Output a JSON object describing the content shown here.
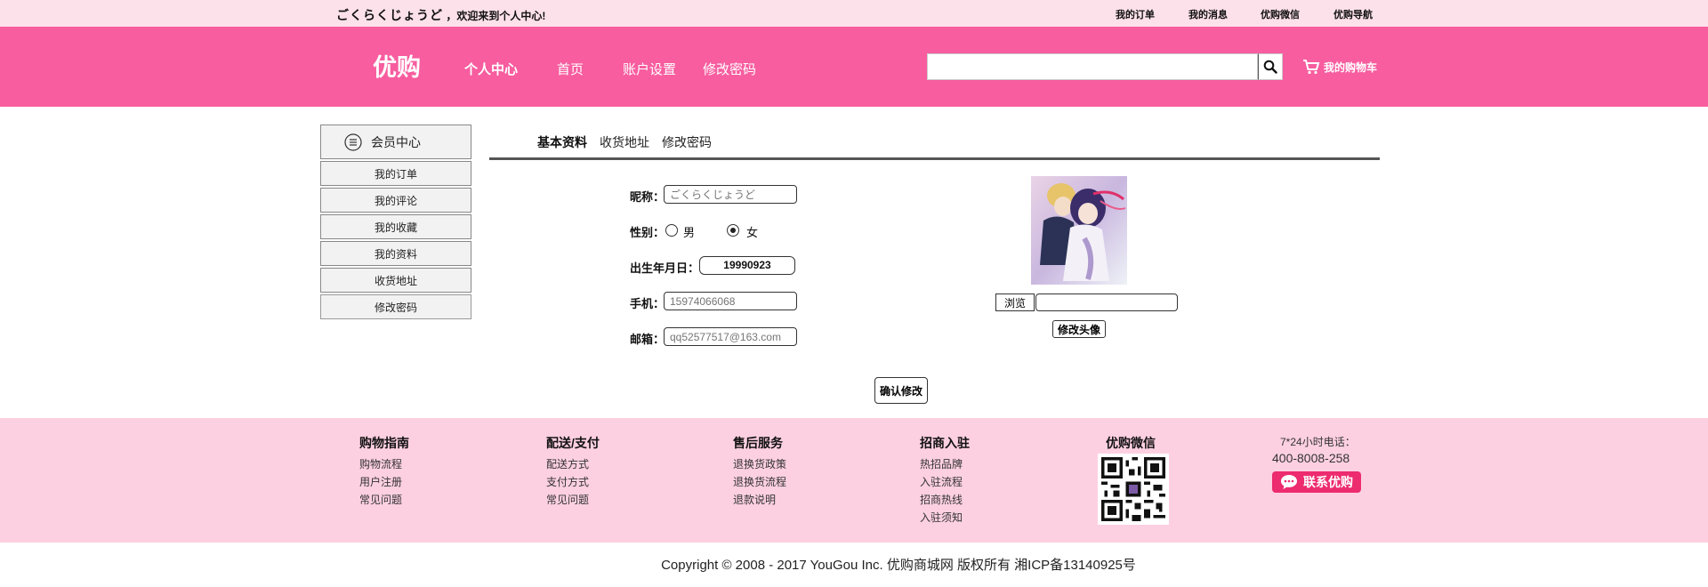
{
  "topbar": {
    "username": "ごくらくじょうど",
    "welcome_text": "，欢迎来到个人中心!",
    "links": [
      "我的订单",
      "我的消息",
      "优购微信",
      "优购导航"
    ]
  },
  "header": {
    "logo": "优购",
    "nav": [
      "个人中心",
      "首页",
      "账户设置",
      "修改密码"
    ],
    "search_value": "",
    "cart_label": "我的购物车"
  },
  "sidebar": {
    "title": "会员中心",
    "items": [
      "我的订单",
      "我的评论",
      "我的收藏",
      "我的资料",
      "收货地址",
      "修改密码"
    ]
  },
  "tabs": [
    "基本资料",
    "收货地址",
    "修改密码"
  ],
  "form": {
    "nickname_label": "昵称：",
    "nickname_placeholder": "ごくらくじょうど",
    "gender_label": "性别：",
    "gender_options": [
      "男",
      "女"
    ],
    "gender_selected": "女",
    "birthday_label": "出生年月日：",
    "birthday_value": "19990923",
    "phone_label": "手机：",
    "phone_placeholder": "15974066068",
    "email_label": "邮箱：",
    "email_placeholder": "qq52577517@163.com",
    "confirm_label": "确认修改"
  },
  "avatar": {
    "browse_label": "浏览",
    "file_name": "",
    "change_label": "修改头像"
  },
  "footer": {
    "columns": [
      {
        "title": "购物指南",
        "links": [
          "购物流程",
          "用户注册",
          "常见问题"
        ]
      },
      {
        "title": "配送/支付",
        "links": [
          "配送方式",
          "支付方式",
          "常见问题"
        ]
      },
      {
        "title": "售后服务",
        "links": [
          "退换货政策",
          "退换货流程",
          "退款说明"
        ]
      },
      {
        "title": "招商入驻",
        "links": [
          "热招品牌",
          "入驻流程",
          "招商热线",
          "入驻须知"
        ]
      }
    ],
    "wechat_title": "优购微信",
    "hotline_label": "7*24小时电话：",
    "hotline": "400-8008-258",
    "contact_label": "联系优购"
  },
  "copyright": "Copyright © 2008 - 2017 YouGou Inc. 优购商城网  版权所有     湘ICP备13140925号",
  "colors": {
    "header": "#f75d9f",
    "topbar": "#fde1ea",
    "footer": "#fdd0e1",
    "contact": "#ed2b6f"
  }
}
